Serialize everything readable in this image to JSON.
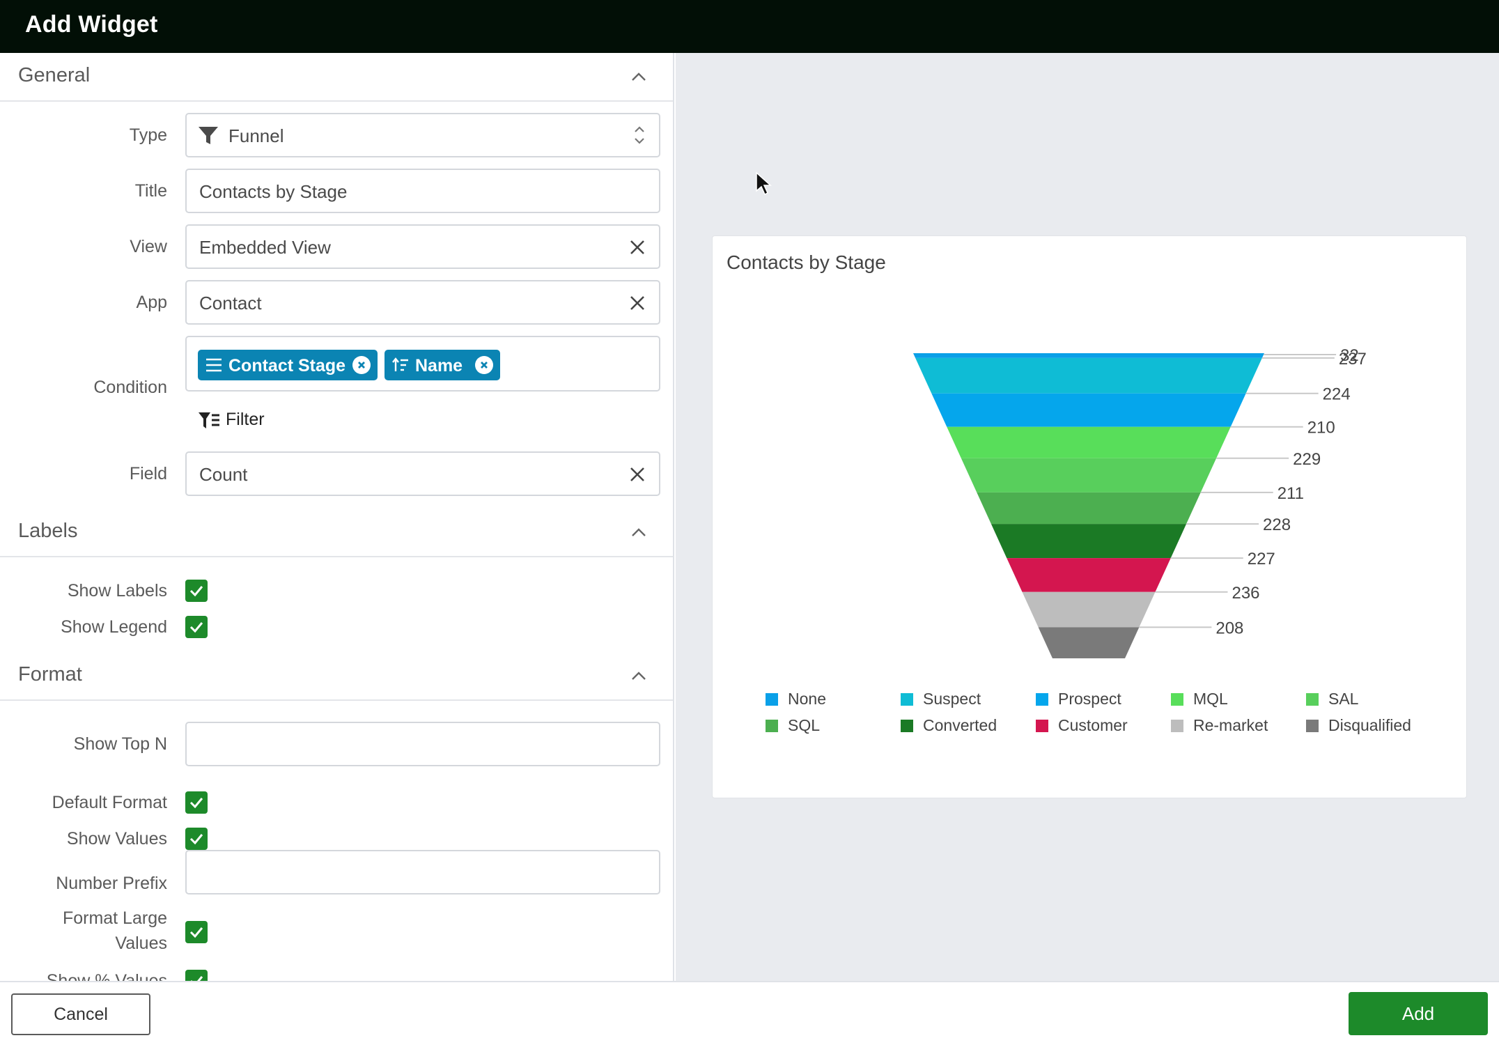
{
  "window": {
    "title": "Add Widget"
  },
  "sections": {
    "general": {
      "title": "General"
    },
    "labels": {
      "title": "Labels"
    },
    "format": {
      "title": "Format"
    }
  },
  "general": {
    "type": {
      "label": "Type",
      "value": "Funnel",
      "icon": "funnel-icon"
    },
    "title": {
      "label": "Title",
      "value": "Contacts by Stage"
    },
    "view": {
      "label": "View",
      "value": "Embedded View"
    },
    "app": {
      "label": "App",
      "value": "Contact"
    },
    "condition": {
      "label": "Condition",
      "chips": [
        {
          "label": "Contact Stage",
          "icon": "group-lines-icon"
        },
        {
          "label": "Name",
          "icon": "sort-icon"
        }
      ],
      "filter_label": "Filter"
    },
    "field": {
      "label": "Field",
      "value": "Count"
    }
  },
  "labels": {
    "show_labels": {
      "label": "Show Labels",
      "checked": true
    },
    "show_legend": {
      "label": "Show Legend",
      "checked": true
    }
  },
  "format": {
    "show_top_n": {
      "label": "Show Top N",
      "value": ""
    },
    "default_format": {
      "label": "Default Format",
      "checked": true
    },
    "show_values": {
      "label": "Show Values",
      "checked": true
    },
    "number_prefix": {
      "label": "Number Prefix",
      "value": ""
    },
    "format_large_values": {
      "label_line1": "Format Large",
      "label_line2": "Values",
      "checked": true
    },
    "show_pct_values": {
      "label": "Show % Values",
      "checked": true
    }
  },
  "buttons": {
    "cancel": "Cancel",
    "add": "Add"
  },
  "colors": {
    "accent_green": "#1d8a2a",
    "chip_blue": "#0b84b3",
    "topbar": "#020f06"
  },
  "chart_data": {
    "type": "funnel",
    "title": "Contacts by Stage",
    "categories": [
      "None",
      "Suspect",
      "Prospect",
      "MQL",
      "SAL",
      "SQL",
      "Converted",
      "Customer",
      "Re-market",
      "Disqualified"
    ],
    "values": [
      32,
      237,
      224,
      210,
      229,
      211,
      228,
      227,
      236,
      208
    ],
    "colors": [
      "#0aa0e8",
      "#0fbcd5",
      "#05a6ec",
      "#58de5a",
      "#58cf5c",
      "#4caf50",
      "#1b7a25",
      "#d4164f",
      "#bdbdbd",
      "#7a7a7a"
    ],
    "legend_position": "bottom",
    "show_labels": true
  }
}
